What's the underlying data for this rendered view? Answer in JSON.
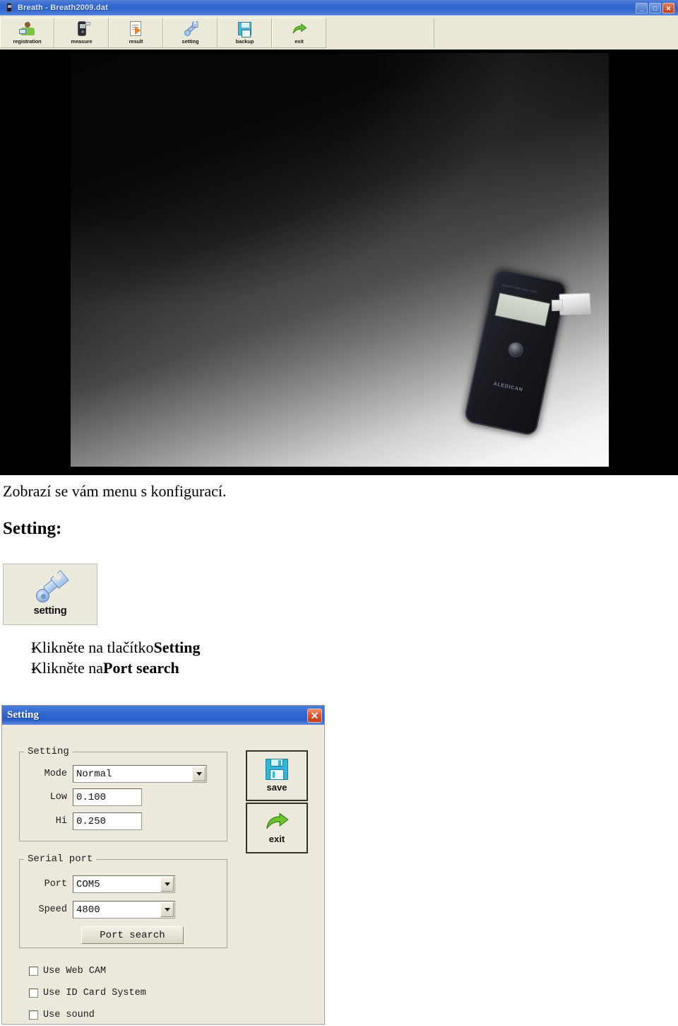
{
  "app_window": {
    "title": "Breath - Breath2009.dat",
    "title_icon": "device-icon",
    "window_controls": {
      "minimize": "_",
      "maximize": "□",
      "close": "✕"
    },
    "toolbar": [
      {
        "label": "registration",
        "icon": "user-registration-icon"
      },
      {
        "label": "measure",
        "icon": "breathalyzer-device-icon"
      },
      {
        "label": "result",
        "icon": "document-export-icon"
      },
      {
        "label": "setting",
        "icon": "wrench-icon"
      },
      {
        "label": "backup",
        "icon": "floppy-disk-icon"
      },
      {
        "label": "exit",
        "icon": "green-arrow-icon"
      }
    ],
    "photo": {
      "alt": "Black handheld breathalyzer device with mouthpiece on gradient background",
      "device_brand_top": "BREATH BREATHALYZER",
      "device_brand_bottom": "ALEDICAN"
    }
  },
  "document": {
    "paragraph": "Zobrazí se vám menu s konfigurací.",
    "heading": "Setting:",
    "setting_thumb": {
      "label": "setting",
      "icon": "wrench-icon"
    },
    "bullets": [
      {
        "dash": "-",
        "text_before": "Klikněte na tlačítko ",
        "bold": "Setting",
        "text_after": ""
      },
      {
        "dash": "-",
        "text_before": "Klikněte na ",
        "bold": "Port search",
        "text_after": ""
      }
    ]
  },
  "dialog": {
    "title": "Setting",
    "close_glyph": "✕",
    "groups": {
      "setting": {
        "legend": "Setting",
        "fields": [
          {
            "label": "Mode",
            "type": "combo",
            "value": "Normal"
          },
          {
            "label": "Low",
            "type": "textbox",
            "value": "0.100"
          },
          {
            "label": "Hi",
            "type": "textbox",
            "value": "0.250"
          }
        ]
      },
      "serial_port": {
        "legend": "Serial port",
        "fields": [
          {
            "label": "Port",
            "type": "combo",
            "value": "COM5"
          },
          {
            "label": "Speed",
            "type": "combo",
            "value": "4800"
          }
        ],
        "button": "Port search"
      }
    },
    "side_buttons": [
      {
        "label": "save",
        "icon": "floppy-disk-icon"
      },
      {
        "label": "exit",
        "icon": "green-arrow-icon"
      }
    ],
    "checkboxes": [
      {
        "label": "Use Web CAM",
        "checked": false
      },
      {
        "label": "Use ID Card System",
        "checked": false
      },
      {
        "label": "Use sound",
        "checked": false
      }
    ]
  },
  "colors": {
    "titlebar_blue": "#2f66cf",
    "dialog_face": "#ece9dc",
    "toolbar_face": "#e9e7d8",
    "accent_red": "#c53a18"
  }
}
